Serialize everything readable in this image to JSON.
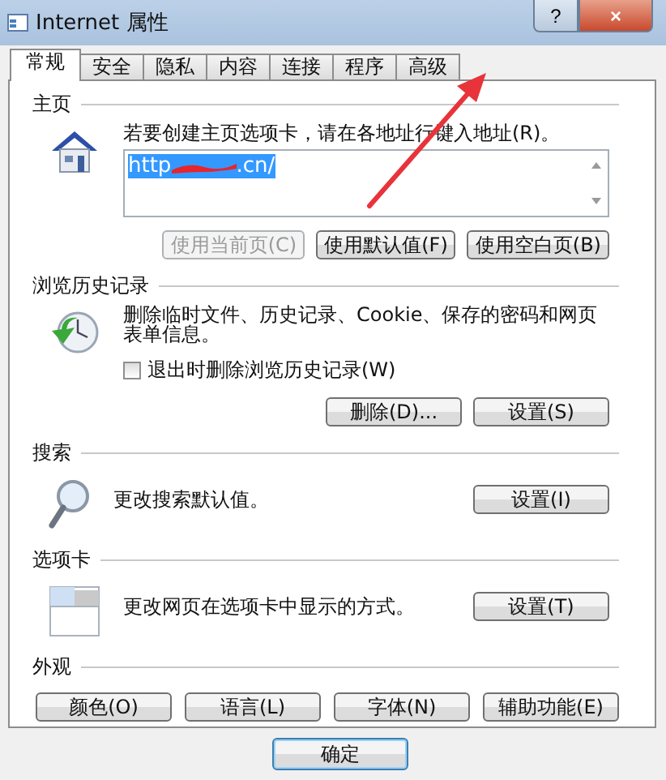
{
  "window": {
    "title": "Internet 属性",
    "controls": [
      "?",
      "×"
    ]
  },
  "tabs": [
    {
      "label": "常规",
      "selected": true
    },
    {
      "label": "安全",
      "selected": false
    },
    {
      "label": "隐私",
      "selected": false
    },
    {
      "label": "内容",
      "selected": false
    },
    {
      "label": "连接",
      "selected": false
    },
    {
      "label": "程序",
      "selected": false
    },
    {
      "label": "高级",
      "selected": false
    }
  ],
  "homepage": {
    "heading": "主页",
    "text": "若要创建主页选项卡，请在各地址行键入地址(R)。",
    "url_start": "http",
    "url_end": ".cn/",
    "redacted": true,
    "buttons": [
      {
        "label": "使用当前页(C)",
        "disabled": true
      },
      {
        "label": "使用默认值(F)",
        "disabled": false
      },
      {
        "label": "使用空白页(B)",
        "disabled": false
      }
    ]
  },
  "history": {
    "heading": "浏览历史记录",
    "text": "删除临时文件、历史记录、Cookie、保存的密码和网页表单信息。",
    "checkbox": {
      "label": "退出时删除浏览历史记录(W)",
      "checked": false
    },
    "buttons": [
      {
        "label": "删除(D)...",
        "disabled": false
      },
      {
        "label": "设置(S)",
        "disabled": false
      }
    ]
  },
  "search": {
    "heading": "搜索",
    "text": "更改搜索默认值。",
    "buttons": [
      {
        "label": "设置(I)",
        "disabled": false
      }
    ]
  },
  "tabs_section": {
    "heading": "选项卡",
    "text": "更改网页在选项卡中显示的方式。",
    "buttons": [
      {
        "label": "设置(T)",
        "disabled": false
      }
    ]
  },
  "appearance": {
    "heading": "外观",
    "buttons": [
      {
        "label": "颜色(O)",
        "disabled": false
      },
      {
        "label": "语言(L)",
        "disabled": false
      },
      {
        "label": "字体(N)",
        "disabled": false
      },
      {
        "label": "辅助功能(E)",
        "disabled": false
      }
    ]
  },
  "footer": {
    "buttons": [
      {
        "label": "确定",
        "default": true
      }
    ]
  },
  "annotation": {
    "kind": "arrow"
  }
}
